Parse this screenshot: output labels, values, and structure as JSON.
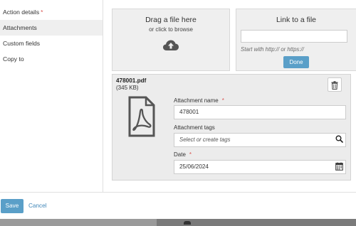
{
  "sidebar": {
    "items": [
      {
        "label": "Action details",
        "required": "*"
      },
      {
        "label": "Attachments"
      },
      {
        "label": "Custom fields"
      },
      {
        "label": "Copy to"
      }
    ]
  },
  "upload": {
    "drop_title": "Drag a file here",
    "drop_subtitle": "or click to browse",
    "icon": "cloud-upload-icon"
  },
  "link": {
    "title": "Link to a file",
    "input_value": "",
    "hint": "Start with http:// or https://",
    "done_label": "Done"
  },
  "attachment": {
    "file_name": "478001.pdf",
    "file_size": "(345 KB)",
    "file_icon": "pdf-file-icon",
    "name_label": "Attachment name",
    "name_required": "*",
    "name_value": "478001",
    "tags_label": "Attachment tags",
    "tags_placeholder": "Select or create tags",
    "date_label": "Date",
    "date_required": "*",
    "date_value": "25/06/2024"
  },
  "footer": {
    "save_label": "Save",
    "cancel_label": "Cancel"
  },
  "colors": {
    "accent": "#5a9fc8",
    "link": "#3f86b8",
    "required": "#d9534f",
    "panel_bg": "#efefef"
  }
}
